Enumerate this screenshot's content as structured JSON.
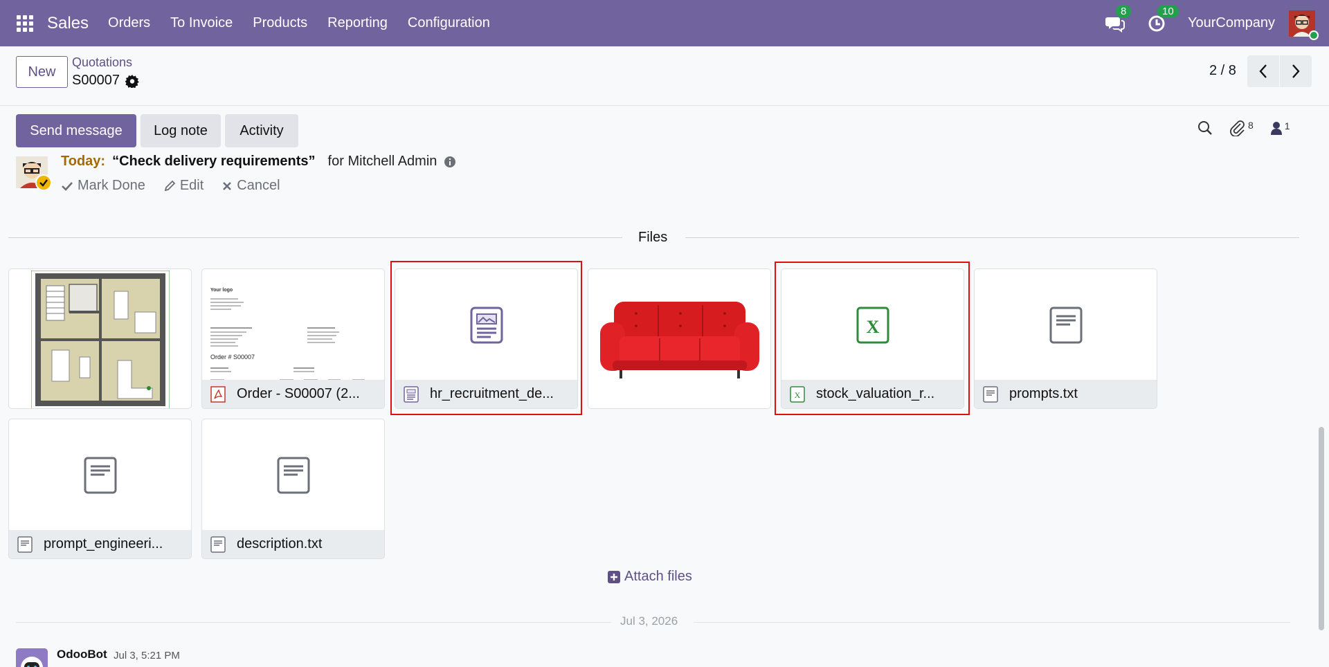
{
  "navbar": {
    "app_name": "Sales",
    "menu": [
      "Orders",
      "To Invoice",
      "Products",
      "Reporting",
      "Configuration"
    ],
    "messages_count": "8",
    "activities_count": "10",
    "company": "YourCompany",
    "bg_color": "#71639e"
  },
  "control_panel": {
    "new_label": "New",
    "breadcrumb_parent": "Quotations",
    "record_name": "S00007",
    "pager": "2 / 8"
  },
  "chatter": {
    "send_message": "Send message",
    "log_note": "Log note",
    "activity": "Activity",
    "attachments_count": "8",
    "followers_count": "1"
  },
  "activity": {
    "when": "Today:",
    "summary": "“Check delivery requirements”",
    "assigned": "for Mitchell Admin",
    "mark_done": "Mark Done",
    "edit": "Edit",
    "cancel": "Cancel"
  },
  "files": {
    "title": "Files",
    "items": [
      {
        "name": "",
        "kind": "image-floorplan"
      },
      {
        "name": "Order - S00007 (2...",
        "kind": "pdf"
      },
      {
        "name": "hr_recruitment_de...",
        "kind": "document",
        "highlighted": true
      },
      {
        "name": "",
        "kind": "image-sofa"
      },
      {
        "name": "stock_valuation_r...",
        "kind": "spreadsheet",
        "highlighted": true
      },
      {
        "name": "prompts.txt",
        "kind": "text"
      },
      {
        "name": "prompt_engineeri...",
        "kind": "text"
      },
      {
        "name": "description.txt",
        "kind": "text"
      }
    ],
    "attach_label": "Attach files"
  },
  "thread": {
    "date_separator": "Jul 3, 2026",
    "author": "OdooBot",
    "time": "Jul 3, 5:21 PM"
  },
  "pdf_preview": {
    "logo": "Your logo",
    "heading": "Order # S00007"
  },
  "colors": {
    "accent": "#71639e",
    "highlight": "#e10e0e",
    "success": "#22a04b",
    "warning": "#a36a00"
  }
}
